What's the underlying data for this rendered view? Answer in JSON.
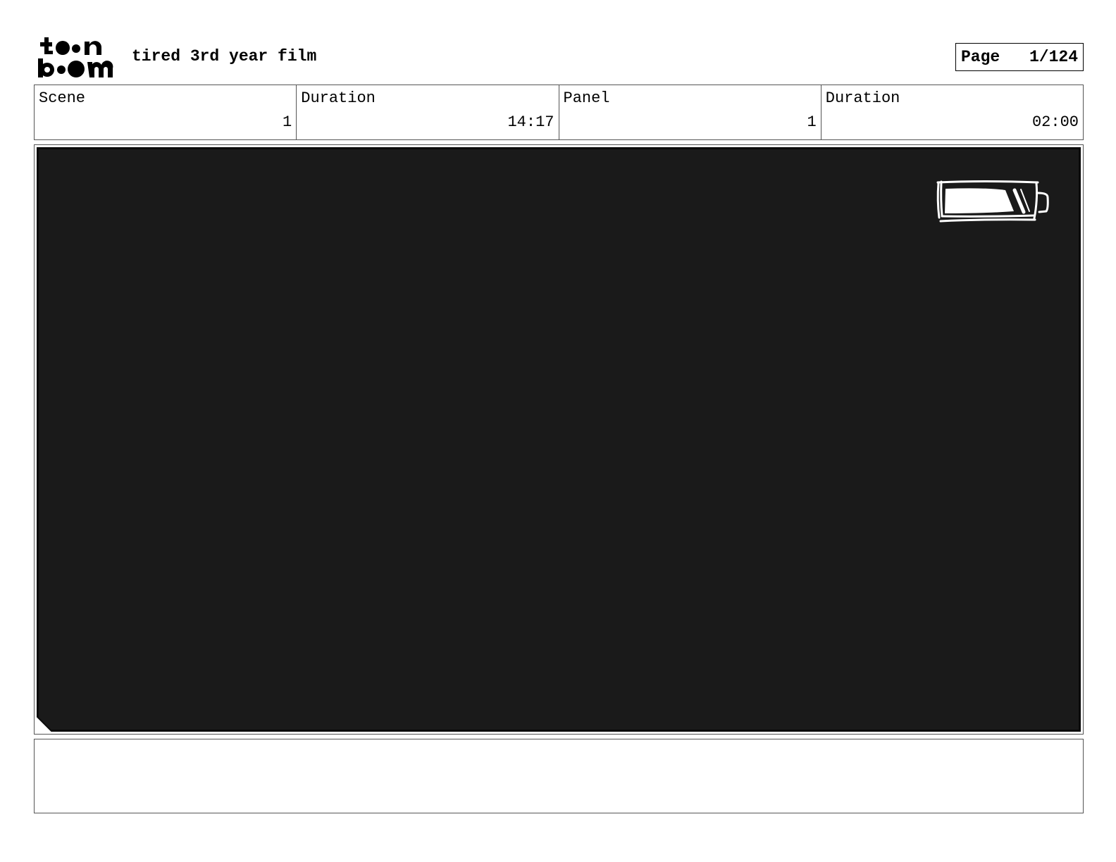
{
  "header": {
    "logo": {
      "icon": "toon-boom-logo",
      "lines": [
        "t●●n",
        "b●●m"
      ]
    },
    "project_title": "tired 3rd year film",
    "page": {
      "label": "Page",
      "value": "1/124"
    }
  },
  "info": {
    "scene": {
      "label": "Scene",
      "value": "1"
    },
    "scene_duration": {
      "label": "Duration",
      "value": "14:17"
    },
    "panel": {
      "label": "Panel",
      "value": "1"
    },
    "panel_duration": {
      "label": "Duration",
      "value": "02:00"
    }
  },
  "panel": {
    "background_color": "#1a1a1a",
    "sketch_icon": "battery-icon"
  },
  "notes": {
    "text": ""
  }
}
